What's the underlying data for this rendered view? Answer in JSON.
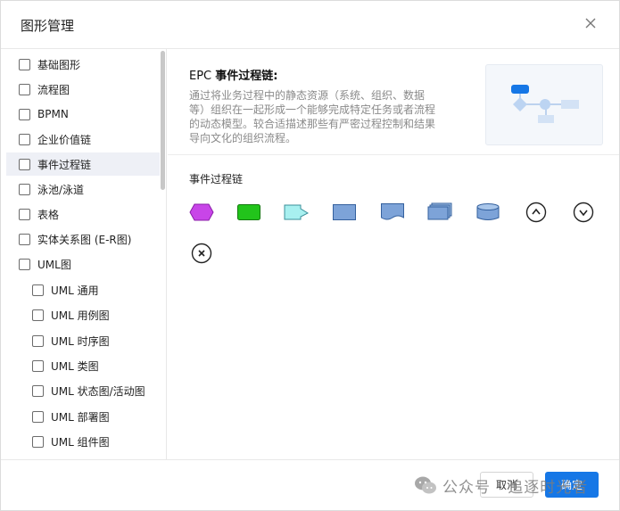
{
  "dialog": {
    "title": "图形管理"
  },
  "sidebar": {
    "items": [
      {
        "label": "基础图形"
      },
      {
        "label": "流程图"
      },
      {
        "label": "BPMN"
      },
      {
        "label": "企业价值链"
      },
      {
        "label": "事件过程链"
      },
      {
        "label": "泳池/泳道"
      },
      {
        "label": "表格"
      },
      {
        "label": "实体关系图 (E-R图)"
      },
      {
        "label": "UML图"
      },
      {
        "label": "UML 通用"
      },
      {
        "label": "UML 用例图"
      },
      {
        "label": "UML 时序图"
      },
      {
        "label": "UML 类图"
      },
      {
        "label": "UML 状态图/活动图"
      },
      {
        "label": "UML 部署图"
      },
      {
        "label": "UML 组件图"
      }
    ]
  },
  "main": {
    "desc_title_prefix": "EPC ",
    "desc_title_bold": "事件过程链:",
    "desc_lines": [
      "通过将业务过程中的静态资源（系统、组织、数据",
      "等）组织在一起形成一个能够完成特定任务或者流程",
      "的动态模型。较合适描述那些有严密过程控制和结果",
      "导向文化的组织流程。"
    ],
    "section_label": "事件过程链",
    "shapes": [
      {
        "icon": "epc-event-hexagon-icon",
        "color": "#c845e8"
      },
      {
        "icon": "epc-function-rect-icon",
        "color": "#22c41b"
      },
      {
        "icon": "epc-information-object-icon",
        "color": "#a8f0f0"
      },
      {
        "icon": "epc-system-rect-icon",
        "color": "#7da3d8"
      },
      {
        "icon": "epc-document-icon",
        "color": "#7da3d8"
      },
      {
        "icon": "epc-multi-document-icon",
        "color": "#7da3d8"
      },
      {
        "icon": "epc-database-cylinder-icon",
        "color": "#7da3d8"
      },
      {
        "icon": "epc-and-connector-icon",
        "color": "#333333"
      },
      {
        "icon": "epc-or-connector-icon",
        "color": "#333333"
      },
      {
        "icon": "epc-xor-connector-icon",
        "color": "#333333"
      }
    ]
  },
  "footer": {
    "cancel_label": "取消",
    "ok_label": "确定"
  },
  "watermark": {
    "text": "公众号 · 追逐时光者"
  },
  "colors": {
    "accent": "#1677e6",
    "selected_bg": "#eef0f6"
  }
}
